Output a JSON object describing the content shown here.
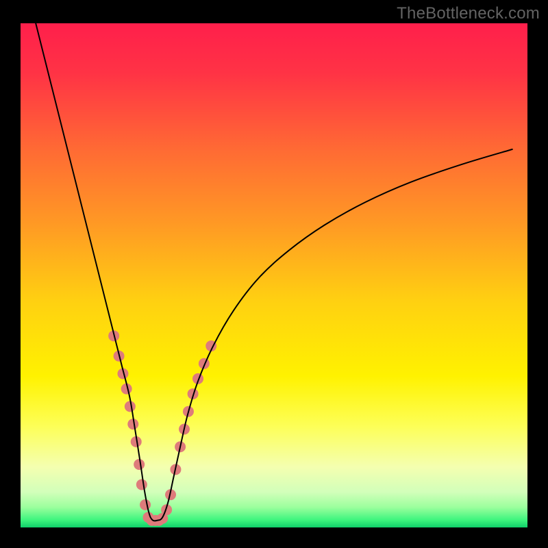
{
  "watermark": "TheBottleneck.com",
  "chart_data": {
    "type": "line",
    "title": "",
    "xlabel": "",
    "ylabel": "",
    "xlim": [
      0,
      100
    ],
    "ylim": [
      0,
      100
    ],
    "grid": false,
    "legend": false,
    "background": {
      "type": "vertical-gradient",
      "stops": [
        {
          "offset": 0.0,
          "color": "#ff1f4b"
        },
        {
          "offset": 0.1,
          "color": "#ff3345"
        },
        {
          "offset": 0.25,
          "color": "#ff6a34"
        },
        {
          "offset": 0.4,
          "color": "#ff9a24"
        },
        {
          "offset": 0.55,
          "color": "#ffd011"
        },
        {
          "offset": 0.7,
          "color": "#fff200"
        },
        {
          "offset": 0.8,
          "color": "#fdff58"
        },
        {
          "offset": 0.88,
          "color": "#f4ffb0"
        },
        {
          "offset": 0.93,
          "color": "#d2ffba"
        },
        {
          "offset": 0.96,
          "color": "#9bff9d"
        },
        {
          "offset": 0.985,
          "color": "#3ef57e"
        },
        {
          "offset": 1.0,
          "color": "#10d069"
        }
      ]
    },
    "series": [
      {
        "name": "bottleneck-curve",
        "color": "#000000",
        "stroke_width": 2,
        "x": [
          3,
          5,
          7,
          9,
          11,
          13,
          15,
          17,
          18.5,
          20,
          21.5,
          22.5,
          23.6,
          24.5,
          25.3,
          26,
          27,
          28,
          29.1,
          30.2,
          31.5,
          33,
          35,
          38,
          42,
          47,
          53,
          60,
          68,
          77,
          87,
          97
        ],
        "y": [
          100,
          92,
          84,
          76,
          68,
          60,
          52,
          44,
          38,
          32,
          26,
          20,
          13,
          7,
          3,
          1.5,
          1.4,
          2,
          5,
          10,
          16,
          22.5,
          29,
          36,
          43,
          49.5,
          55,
          60,
          64.5,
          68.5,
          72,
          75
        ]
      }
    ],
    "markers": {
      "name": "highlight-dots",
      "color": "#de7b7b",
      "radius": 8,
      "points": [
        {
          "x": 18.4,
          "y": 38.0
        },
        {
          "x": 19.4,
          "y": 34.0
        },
        {
          "x": 20.2,
          "y": 30.5
        },
        {
          "x": 20.9,
          "y": 27.5
        },
        {
          "x": 21.6,
          "y": 24.0
        },
        {
          "x": 22.2,
          "y": 20.5
        },
        {
          "x": 22.8,
          "y": 17.0
        },
        {
          "x": 23.4,
          "y": 12.5
        },
        {
          "x": 23.9,
          "y": 8.5
        },
        {
          "x": 24.6,
          "y": 4.5
        },
        {
          "x": 25.2,
          "y": 2.0
        },
        {
          "x": 25.9,
          "y": 1.4
        },
        {
          "x": 26.6,
          "y": 1.4
        },
        {
          "x": 27.3,
          "y": 1.4
        },
        {
          "x": 28.0,
          "y": 1.8
        },
        {
          "x": 28.8,
          "y": 3.5
        },
        {
          "x": 29.6,
          "y": 6.5
        },
        {
          "x": 30.6,
          "y": 11.5
        },
        {
          "x": 31.5,
          "y": 16.0
        },
        {
          "x": 32.3,
          "y": 19.5
        },
        {
          "x": 33.1,
          "y": 23.0
        },
        {
          "x": 34.0,
          "y": 26.5
        },
        {
          "x": 35.0,
          "y": 29.5
        },
        {
          "x": 36.2,
          "y": 32.5
        },
        {
          "x": 37.6,
          "y": 36.0
        }
      ]
    },
    "frame": {
      "outer_border_color": "#000000",
      "outer_border_width_top": 34,
      "outer_border_width_sides": 30,
      "outer_border_width_bottom": 30
    }
  }
}
